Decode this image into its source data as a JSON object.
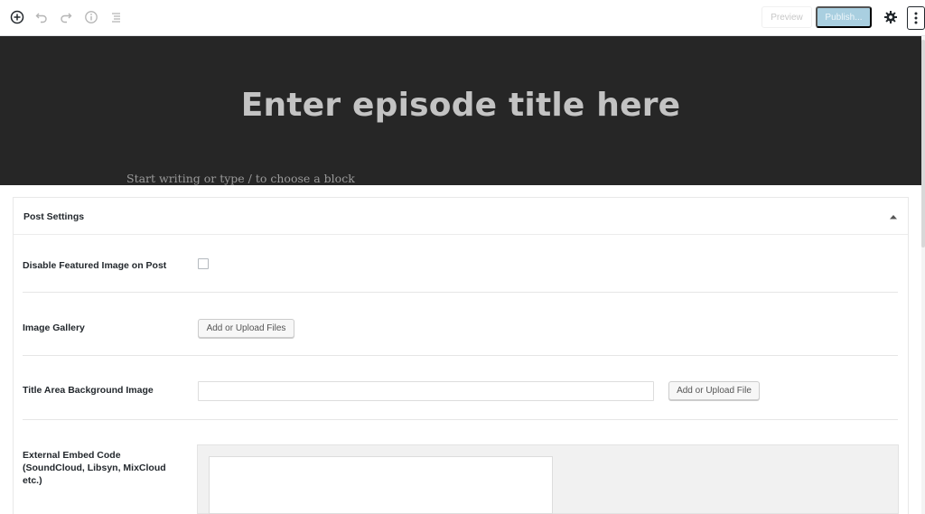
{
  "toolbar": {
    "icons": {
      "add": "plus-circle-icon",
      "undo": "undo-icon",
      "redo": "redo-icon",
      "info": "info-icon",
      "outline": "list-icon",
      "settings": "gear-icon",
      "more": "more-vertical-icon"
    },
    "preview_label": "Preview",
    "publish_label": "Publish...",
    "colors": {
      "publish_bg": "#a9cfe0",
      "header_bg": "#262626"
    }
  },
  "editor": {
    "title_placeholder": "Enter episode title here",
    "block_placeholder": "Start writing or type / to choose a block"
  },
  "post_settings": {
    "title": "Post Settings",
    "rows": [
      {
        "label": "Disable Featured Image on Post",
        "control": "checkbox",
        "checked": false
      },
      {
        "label": "Image Gallery",
        "control": "button",
        "button_label": "Add or Upload Files"
      },
      {
        "label": "Title Area Background Image",
        "control": "text+button",
        "value": "",
        "button_label": "Add or Upload File"
      },
      {
        "label": "External Embed Code (SoundCloud, Libsyn, MixCloud etc.)",
        "control": "textarea",
        "value": ""
      }
    ]
  }
}
